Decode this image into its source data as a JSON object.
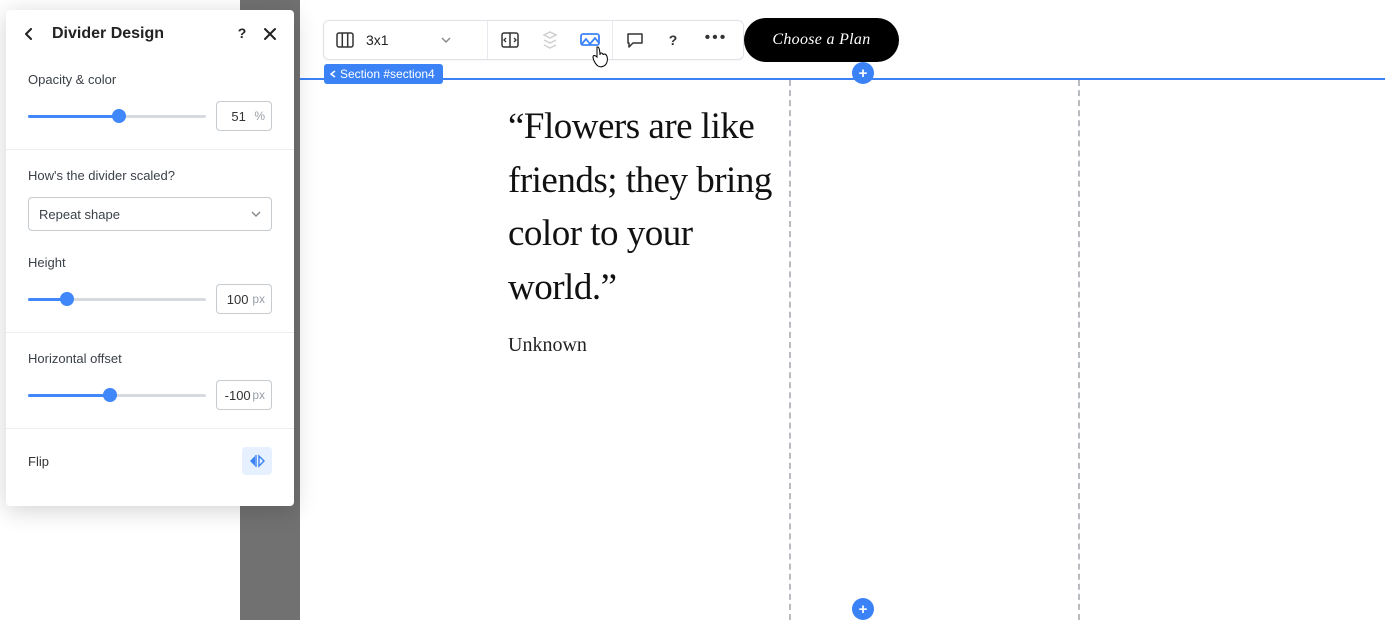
{
  "panel": {
    "title": "Divider Design",
    "opacity": {
      "label": "Opacity & color",
      "value": "51",
      "unit": "%",
      "pct": 51
    },
    "scaleQ": "How's the divider scaled?",
    "scaleMode": "Repeat shape",
    "height": {
      "label": "Height",
      "value": "100",
      "unit": "px",
      "pct": 22
    },
    "offset": {
      "label": "Horizontal offset",
      "value": "-100",
      "unit": "px",
      "pct": 46
    },
    "flip": "Flip"
  },
  "toolbar": {
    "grid": "3x1"
  },
  "cta": "Choose a Plan",
  "sectionTag": "Section #section4",
  "quote": {
    "text": "“Flowers are like friends; they bring color to your world.”",
    "author": "Unknown"
  }
}
